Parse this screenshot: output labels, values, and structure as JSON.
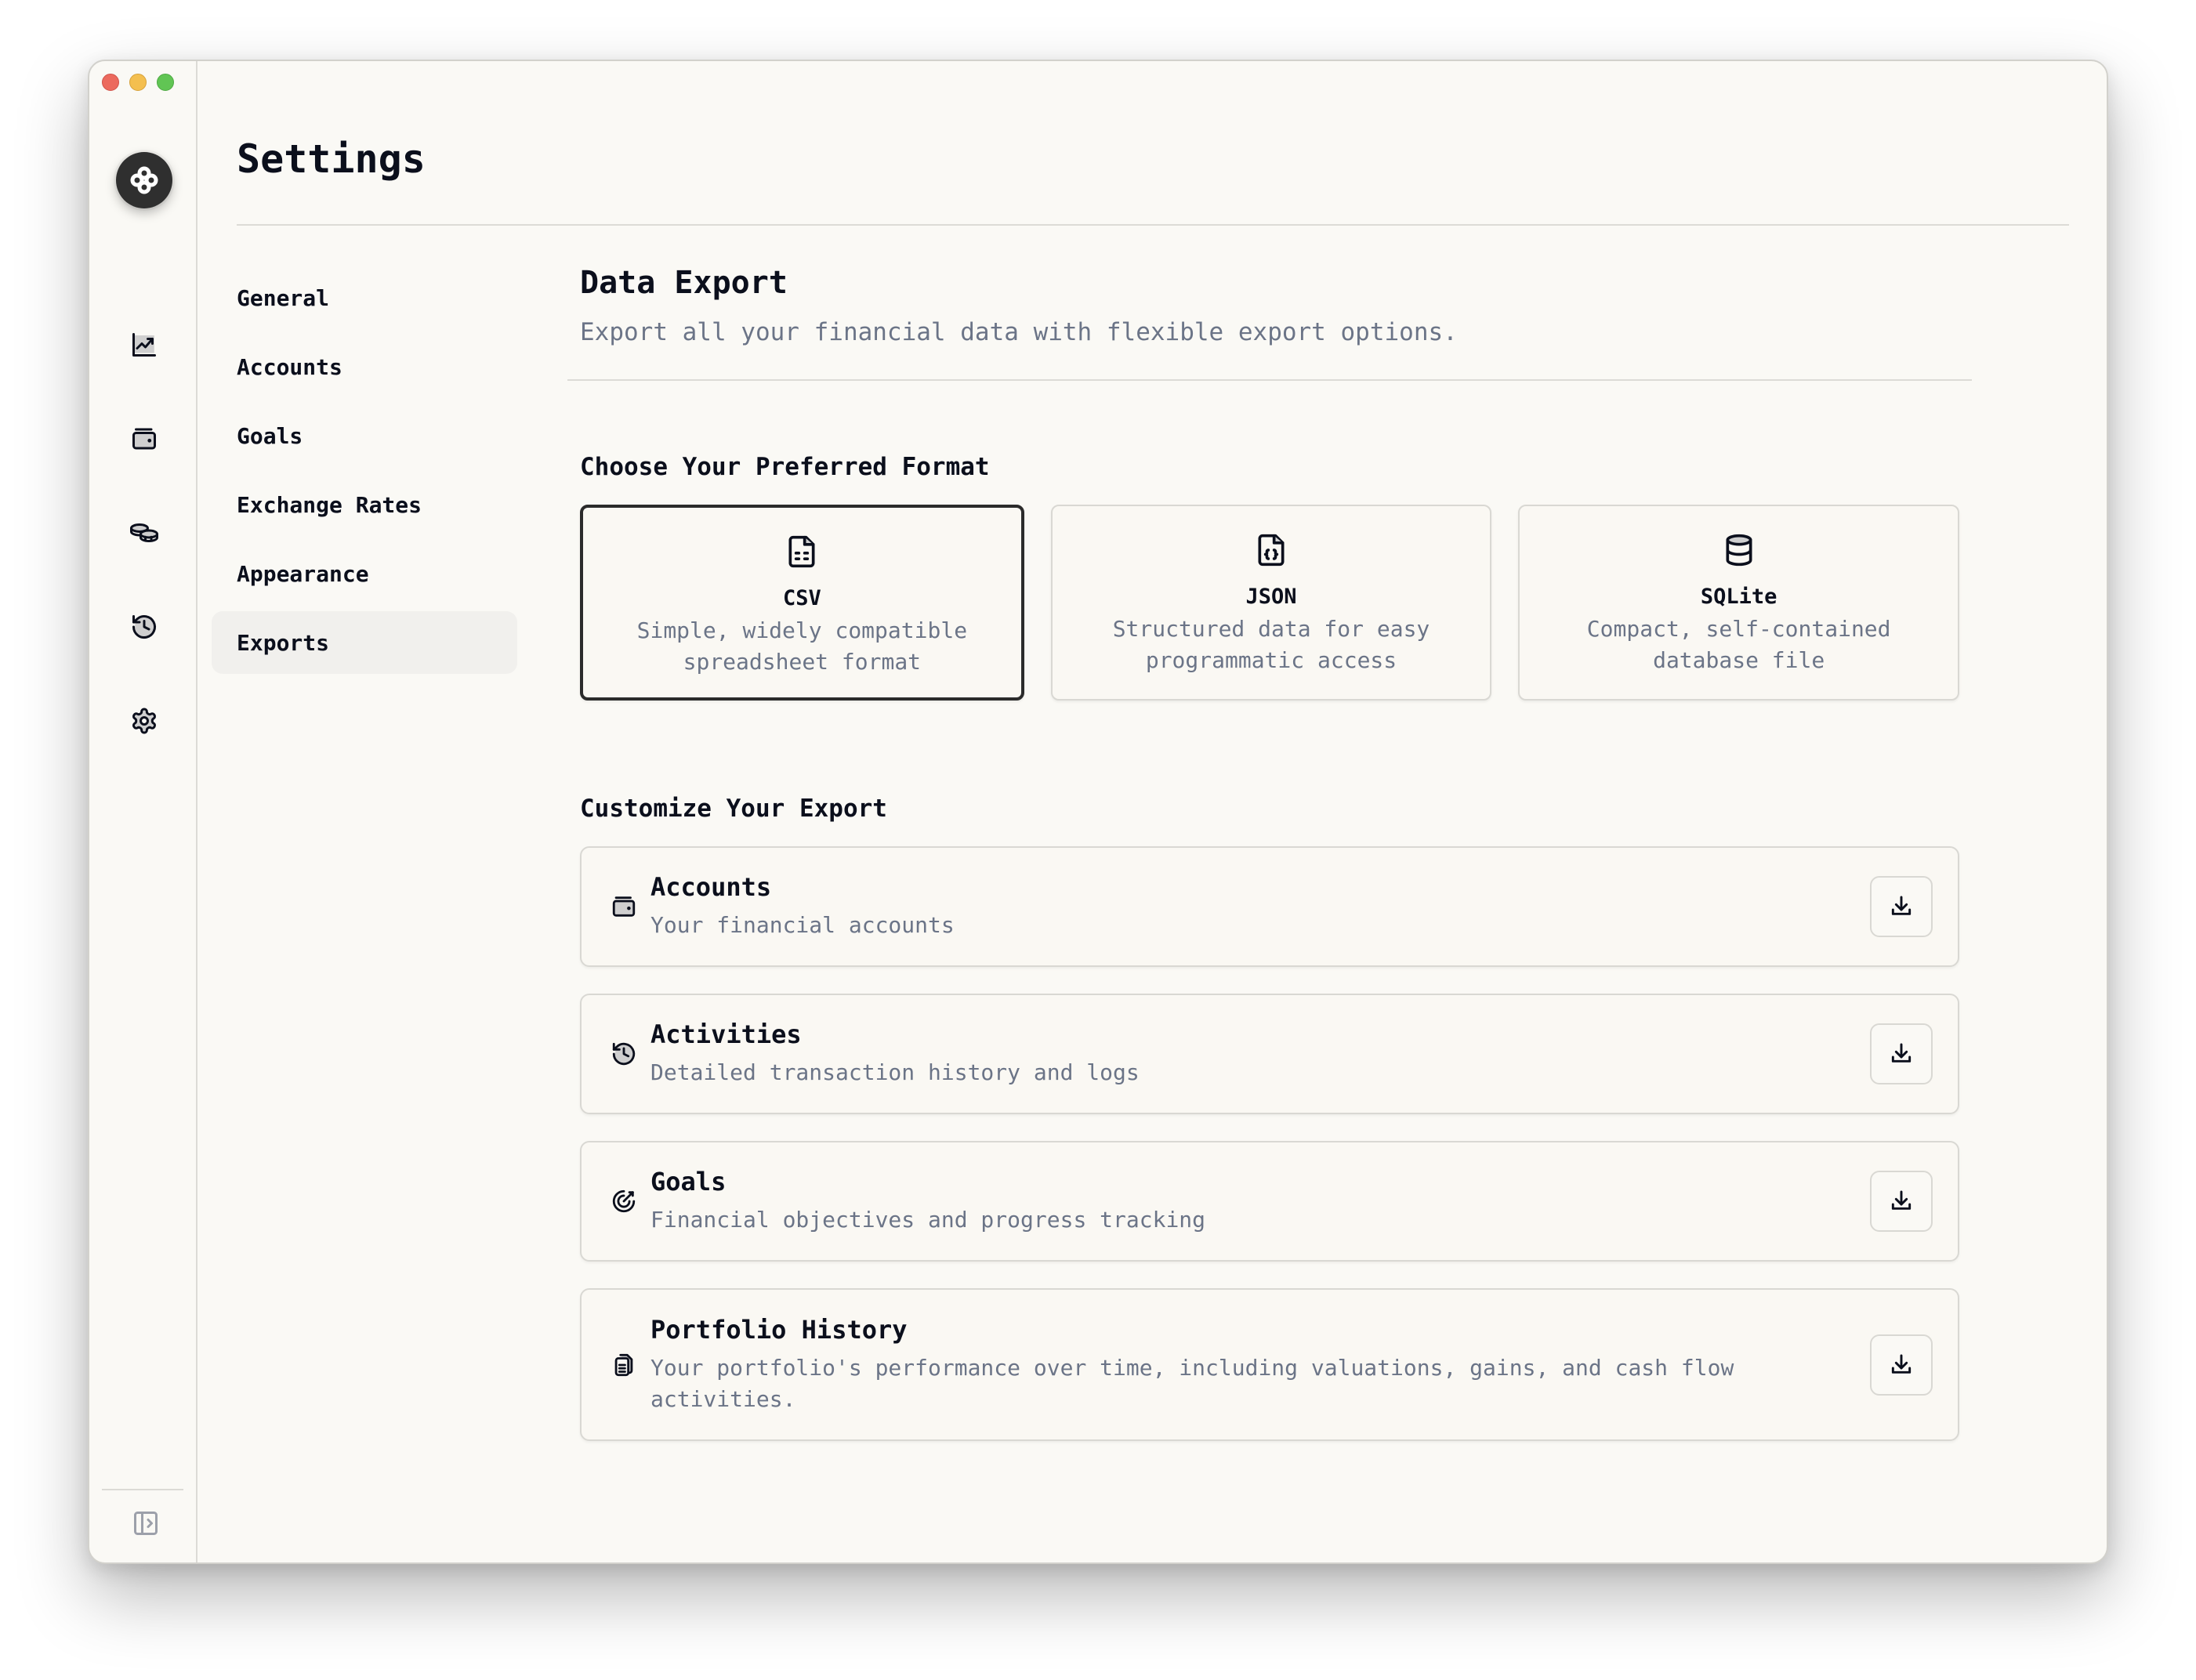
{
  "window": {
    "controls": [
      "close",
      "minimize",
      "maximize"
    ]
  },
  "rail": {
    "logo": "app-logo-icon",
    "items": [
      {
        "icon": "chart-line-icon",
        "label": "Dashboard"
      },
      {
        "icon": "wallet-icon",
        "label": "Accounts"
      },
      {
        "icon": "coins-icon",
        "label": "Holdings"
      },
      {
        "icon": "history-icon",
        "label": "Activities"
      },
      {
        "icon": "gear-icon",
        "label": "Settings"
      }
    ],
    "toggle_icon": "sidebar-expand-icon"
  },
  "header": {
    "title": "Settings"
  },
  "settings_nav": {
    "items": [
      {
        "label": "General",
        "active": false
      },
      {
        "label": "Accounts",
        "active": false
      },
      {
        "label": "Goals",
        "active": false
      },
      {
        "label": "Exchange Rates",
        "active": false
      },
      {
        "label": "Appearance",
        "active": false
      },
      {
        "label": "Exports",
        "active": true
      }
    ]
  },
  "main": {
    "title": "Data Export",
    "subtitle": "Export all your financial data with flexible export options.",
    "format_heading": "Choose Your Preferred Format",
    "selected_format": "CSV",
    "formats": [
      {
        "name": "CSV",
        "icon": "file-spreadsheet-icon",
        "description": "Simple, widely compatible spreadsheet format"
      },
      {
        "name": "JSON",
        "icon": "file-json-icon",
        "description": "Structured data for easy programmatic access"
      },
      {
        "name": "SQLite",
        "icon": "database-icon",
        "description": "Compact, self-contained database file"
      }
    ],
    "customize_heading": "Customize Your Export",
    "exports": [
      {
        "title": "Accounts",
        "icon": "wallet-icon",
        "description": "Your financial accounts"
      },
      {
        "title": "Activities",
        "icon": "history-icon",
        "description": "Detailed transaction history and logs"
      },
      {
        "title": "Goals",
        "icon": "goal-target-icon",
        "description": "Financial objectives and progress tracking"
      },
      {
        "title": "Portfolio History",
        "icon": "files-icon",
        "description": "Your portfolio's performance over time, including valuations, gains, and cash flow activities."
      }
    ],
    "download_icon": "download-icon"
  },
  "colors": {
    "background": "#faf9f5",
    "text": "#0b0f1c",
    "muted_text": "#6b7487",
    "border": "#d9d8d3",
    "selected_border": "#2b2b2b",
    "active_nav_bg": "#f1f0ed"
  }
}
